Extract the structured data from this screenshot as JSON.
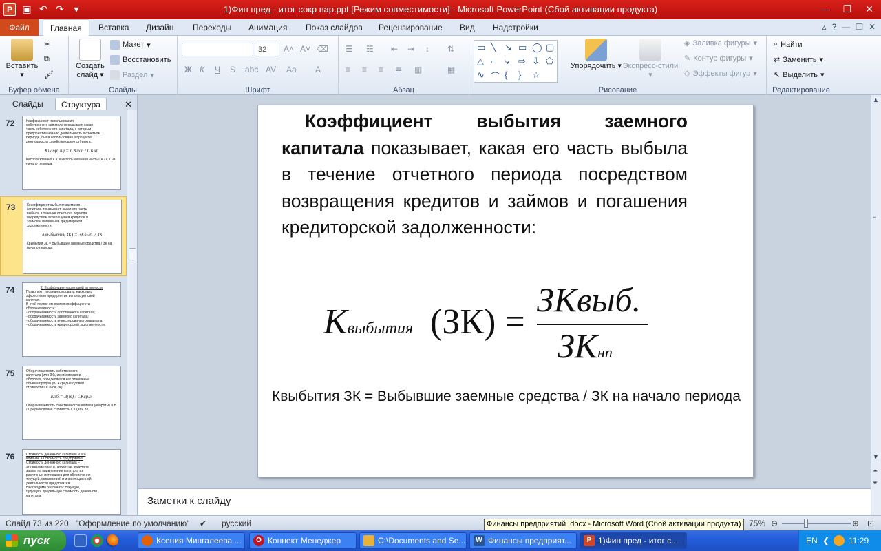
{
  "window": {
    "title": "1)Фин пред - итог сокр вар.ppt [Режим совместимости]  -  Microsoft PowerPoint (Сбой активации продукта)"
  },
  "ribbon": {
    "file_tab": "Файл",
    "tabs": [
      "Главная",
      "Вставка",
      "Дизайн",
      "Переходы",
      "Анимация",
      "Показ слайдов",
      "Рецензирование",
      "Вид",
      "Надстройки"
    ],
    "clipboard": {
      "paste": "Вставить",
      "group": "Буфер обмена"
    },
    "slides": {
      "new_slide": "Создать слайд",
      "layout": "Макет",
      "reset": "Восстановить",
      "section": "Раздел",
      "group": "Слайды"
    },
    "font": {
      "font_name": "",
      "font_size": "32",
      "group": "Шрифт"
    },
    "paragraph": {
      "group": "Абзац"
    },
    "drawing": {
      "arrange": "Упорядочить",
      "quick_styles": "Экспресс-стили",
      "fill": "Заливка фигуры",
      "outline": "Контур фигуры",
      "effects": "Эффекты фигур",
      "group": "Рисование"
    },
    "editing": {
      "find": "Найти",
      "replace": "Заменить",
      "select": "Выделить",
      "group": "Редактирование"
    }
  },
  "left_pane": {
    "tabs": [
      "Слайды",
      "Структура"
    ],
    "thumbnails": [
      {
        "num": "72",
        "lines": [
          "Коэффициент использования",
          "собственного капитала показывает, какая",
          "часть собственного капитала, с которым",
          "предприятие начало деятельность в отчетном",
          "периоде, была использована в процессе",
          "деятельности хозяйствующего субъекта."
        ],
        "formula": "Kисп(СК) = СКисп / СКнп",
        "footer": "Киспользования СК = Использованная часть СК / СК на начало периода"
      },
      {
        "num": "73",
        "lines": [
          "Коэффициент выбытия заемного",
          "капитала показывает, какая его часть",
          "выбыла в течение отчетного периода",
          "посредством возвращения кредитов и",
          "займов и погашения кредиторской",
          "задолженности:"
        ],
        "formula": "Kвыбытия(ЗК) = ЗКвыб. / ЗК",
        "footer": "Квыбытия ЗК = Выбывшие заемные средства / ЗК на начало периода"
      },
      {
        "num": "74",
        "lines": [
          "2. Коэффициенты деловой активности",
          "Позволяют проанализировать, насколько",
          "эффективно предприятие использует свой",
          "капитал.",
          "В этой группе относятся коэффициенты",
          "оборачиваемости:",
          "- оборачиваемость собственного капитала;",
          "- оборачиваемость заемного капитала;",
          "- оборачиваемость инвестированного капитала;",
          "- оборачиваемость кредиторской задолженности."
        ],
        "formula": "",
        "footer": ""
      },
      {
        "num": "75",
        "lines": [
          "Оборачиваемость собственного",
          "капитала (или ЗК), исчисляемая в",
          "оборотах, определяется как отношение",
          "объема продаж (В) к среднегодовой",
          "стоимости СК (или ЗК)."
        ],
        "formula": "Коб = В(т) / СКср.г.",
        "footer": "Оборачиваемость собственного капитала (обороты) = В / Среднегодовая стоимость СК (или ЗК)"
      },
      {
        "num": "76",
        "lines": [
          "Стоимость денежного капитала и его",
          "влияние на стоимость предприятия",
          "Стоимость денежного капитала –",
          "это выраженная в процентах величина",
          "затрат на привлечение капитала из",
          "различных источников для обеспечения",
          "текущей, финансовой и инвестиционной",
          "деятельности предприятия.",
          "Необходимо различать: текущую,",
          "будущую, предельную стоимость денежного",
          "капитала."
        ],
        "formula": "",
        "footer": ""
      }
    ]
  },
  "slide": {
    "bold_lead": "Коэффициент выбытия заемного капитала",
    "body": " показывает, какая его часть выбыла в течение отчетного периода посредством возвращения кредитов и займов и погашения кредиторской задолженности:",
    "formula": {
      "lhs_main": "K",
      "lhs_sub": "выбытия",
      "lhs_arg": "(ЗК) =",
      "numerator": "ЗКвыб.",
      "denominator_main": "ЗК",
      "denominator_sub": "нп"
    },
    "note_line": "Квыбытия ЗК = Выбывшие заемные средства / ЗК на начало периода"
  },
  "notes": {
    "placeholder": "Заметки к слайду"
  },
  "status": {
    "slide_of": "Слайд 73 из 220",
    "theme": "\"Оформление по умолчанию\"",
    "language": "русский",
    "tooltip": "Финансы предприятий .docx - Microsoft Word (Сбой активации продукта)",
    "zoom": "75%"
  },
  "taskbar": {
    "start": "пуск",
    "tasks": [
      {
        "label": "Ксения Мингалеева ...",
        "icon": "firefox-icon",
        "color": "#e66000"
      },
      {
        "label": "Коннект Менеджер",
        "icon": "opera-icon",
        "color": "#c1121f"
      },
      {
        "label": "C:\\Documents and Se...",
        "icon": "folder-icon",
        "color": "#e8b13a"
      },
      {
        "label": "Финансы предприят...",
        "icon": "word-icon",
        "color": "#2b5797"
      },
      {
        "label": "1)Фин пред - итог с...",
        "icon": "powerpoint-icon",
        "color": "#d24726"
      }
    ],
    "lang": "EN",
    "clock": "11:29"
  }
}
